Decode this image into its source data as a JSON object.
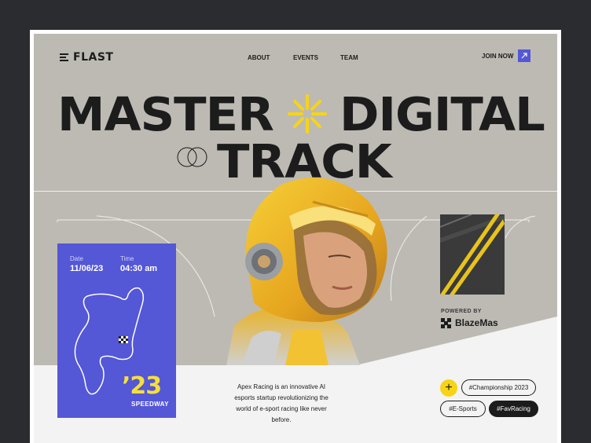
{
  "brand": "FLAST",
  "nav": [
    "ABOUT",
    "EVENTS",
    "TEAM"
  ],
  "cta": "JOIN NOW",
  "headline": {
    "word1": "MASTER",
    "word2": "DIGITAL",
    "word3": "TRACK"
  },
  "event": {
    "date_label": "Date",
    "date": "11/06/23",
    "time_label": "Time",
    "time": "04:30 am",
    "year": "’23",
    "venue": "SPEEDWAY"
  },
  "sponsor": {
    "label": "POWERED BY",
    "name": "BlazeMas"
  },
  "description": "Apex Racing is an innovative AI esports startup revolutionizing the world of e-sport racing like never before.",
  "tags": [
    "#Championship 2023",
    "#E-Sports",
    "#FavRacing"
  ],
  "colors": {
    "accent": "#5457d6",
    "yellow": "#f7d417",
    "hero_bg": "#bdbab4",
    "dark": "#1c1c1c"
  }
}
